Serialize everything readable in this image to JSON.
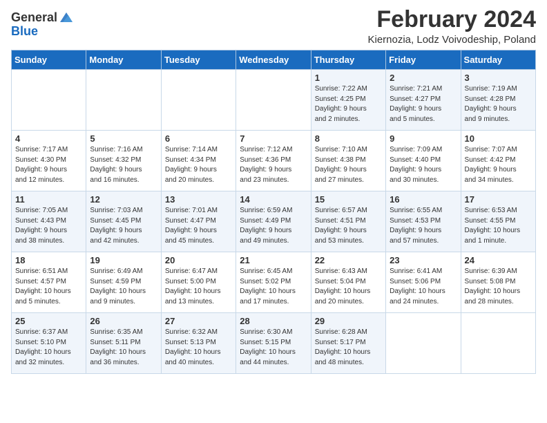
{
  "logo": {
    "general": "General",
    "blue": "Blue"
  },
  "header": {
    "title": "February 2024",
    "subtitle": "Kiernozia, Lodz Voivodeship, Poland"
  },
  "weekdays": [
    "Sunday",
    "Monday",
    "Tuesday",
    "Wednesday",
    "Thursday",
    "Friday",
    "Saturday"
  ],
  "weeks": [
    [
      {
        "day": "",
        "info": ""
      },
      {
        "day": "",
        "info": ""
      },
      {
        "day": "",
        "info": ""
      },
      {
        "day": "",
        "info": ""
      },
      {
        "day": "1",
        "info": "Sunrise: 7:22 AM\nSunset: 4:25 PM\nDaylight: 9 hours\nand 2 minutes."
      },
      {
        "day": "2",
        "info": "Sunrise: 7:21 AM\nSunset: 4:27 PM\nDaylight: 9 hours\nand 5 minutes."
      },
      {
        "day": "3",
        "info": "Sunrise: 7:19 AM\nSunset: 4:28 PM\nDaylight: 9 hours\nand 9 minutes."
      }
    ],
    [
      {
        "day": "4",
        "info": "Sunrise: 7:17 AM\nSunset: 4:30 PM\nDaylight: 9 hours\nand 12 minutes."
      },
      {
        "day": "5",
        "info": "Sunrise: 7:16 AM\nSunset: 4:32 PM\nDaylight: 9 hours\nand 16 minutes."
      },
      {
        "day": "6",
        "info": "Sunrise: 7:14 AM\nSunset: 4:34 PM\nDaylight: 9 hours\nand 20 minutes."
      },
      {
        "day": "7",
        "info": "Sunrise: 7:12 AM\nSunset: 4:36 PM\nDaylight: 9 hours\nand 23 minutes."
      },
      {
        "day": "8",
        "info": "Sunrise: 7:10 AM\nSunset: 4:38 PM\nDaylight: 9 hours\nand 27 minutes."
      },
      {
        "day": "9",
        "info": "Sunrise: 7:09 AM\nSunset: 4:40 PM\nDaylight: 9 hours\nand 30 minutes."
      },
      {
        "day": "10",
        "info": "Sunrise: 7:07 AM\nSunset: 4:42 PM\nDaylight: 9 hours\nand 34 minutes."
      }
    ],
    [
      {
        "day": "11",
        "info": "Sunrise: 7:05 AM\nSunset: 4:43 PM\nDaylight: 9 hours\nand 38 minutes."
      },
      {
        "day": "12",
        "info": "Sunrise: 7:03 AM\nSunset: 4:45 PM\nDaylight: 9 hours\nand 42 minutes."
      },
      {
        "day": "13",
        "info": "Sunrise: 7:01 AM\nSunset: 4:47 PM\nDaylight: 9 hours\nand 45 minutes."
      },
      {
        "day": "14",
        "info": "Sunrise: 6:59 AM\nSunset: 4:49 PM\nDaylight: 9 hours\nand 49 minutes."
      },
      {
        "day": "15",
        "info": "Sunrise: 6:57 AM\nSunset: 4:51 PM\nDaylight: 9 hours\nand 53 minutes."
      },
      {
        "day": "16",
        "info": "Sunrise: 6:55 AM\nSunset: 4:53 PM\nDaylight: 9 hours\nand 57 minutes."
      },
      {
        "day": "17",
        "info": "Sunrise: 6:53 AM\nSunset: 4:55 PM\nDaylight: 10 hours\nand 1 minute."
      }
    ],
    [
      {
        "day": "18",
        "info": "Sunrise: 6:51 AM\nSunset: 4:57 PM\nDaylight: 10 hours\nand 5 minutes."
      },
      {
        "day": "19",
        "info": "Sunrise: 6:49 AM\nSunset: 4:59 PM\nDaylight: 10 hours\nand 9 minutes."
      },
      {
        "day": "20",
        "info": "Sunrise: 6:47 AM\nSunset: 5:00 PM\nDaylight: 10 hours\nand 13 minutes."
      },
      {
        "day": "21",
        "info": "Sunrise: 6:45 AM\nSunset: 5:02 PM\nDaylight: 10 hours\nand 17 minutes."
      },
      {
        "day": "22",
        "info": "Sunrise: 6:43 AM\nSunset: 5:04 PM\nDaylight: 10 hours\nand 20 minutes."
      },
      {
        "day": "23",
        "info": "Sunrise: 6:41 AM\nSunset: 5:06 PM\nDaylight: 10 hours\nand 24 minutes."
      },
      {
        "day": "24",
        "info": "Sunrise: 6:39 AM\nSunset: 5:08 PM\nDaylight: 10 hours\nand 28 minutes."
      }
    ],
    [
      {
        "day": "25",
        "info": "Sunrise: 6:37 AM\nSunset: 5:10 PM\nDaylight: 10 hours\nand 32 minutes."
      },
      {
        "day": "26",
        "info": "Sunrise: 6:35 AM\nSunset: 5:11 PM\nDaylight: 10 hours\nand 36 minutes."
      },
      {
        "day": "27",
        "info": "Sunrise: 6:32 AM\nSunset: 5:13 PM\nDaylight: 10 hours\nand 40 minutes."
      },
      {
        "day": "28",
        "info": "Sunrise: 6:30 AM\nSunset: 5:15 PM\nDaylight: 10 hours\nand 44 minutes."
      },
      {
        "day": "29",
        "info": "Sunrise: 6:28 AM\nSunset: 5:17 PM\nDaylight: 10 hours\nand 48 minutes."
      },
      {
        "day": "",
        "info": ""
      },
      {
        "day": "",
        "info": ""
      }
    ]
  ]
}
